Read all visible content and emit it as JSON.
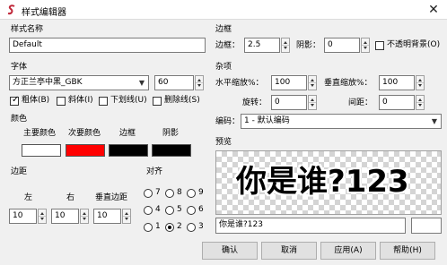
{
  "window": {
    "title": "样式编辑器",
    "close_symbol": "✕"
  },
  "left": {
    "style_name_label": "样式名称",
    "style_name_value": "Default",
    "font_label": "字体",
    "font_name": "方正兰亭中黑_GBK",
    "font_size": "60",
    "bold_label": "粗体(B)",
    "italic_label": "斜体(I)",
    "underline_label": "下划线(U)",
    "strikeout_label": "删除线(S)",
    "bold_checked": true,
    "italic_checked": false,
    "underline_checked": false,
    "strikeout_checked": false,
    "color_label": "颜色",
    "primary_color_label": "主要颜色",
    "secondary_color_label": "次要颜色",
    "outline_color_label": "边框",
    "shadow_color_label": "阴影",
    "primary_color": "#ffffff",
    "secondary_color": "#ff0000",
    "outline_color": "#000000",
    "shadow_color": "#000000",
    "margin_label": "边距",
    "margin_left_label": "左",
    "margin_right_label": "右",
    "margin_vertical_label": "垂直边距",
    "margin_left": "10",
    "margin_right": "10",
    "margin_vertical": "10",
    "align_label": "对齐",
    "align_options": [
      "7",
      "8",
      "9",
      "4",
      "5",
      "6",
      "1",
      "2",
      "3"
    ],
    "align_selected": "2"
  },
  "right": {
    "border_label": "边框",
    "outline_label": "边框：",
    "outline_value": "2.5",
    "shadow_label": "阴影：",
    "shadow_value": "0",
    "opaque_label": "不透明背景(O)",
    "opaque_checked": false,
    "misc_label": "杂项",
    "scale_x_label": "水平缩放%：",
    "scale_x_value": "100",
    "scale_y_label": "垂直缩放%：",
    "scale_y_value": "100",
    "rotation_label": "旋转：",
    "rotation_value": "0",
    "spacing_label": "间距：",
    "spacing_value": "0",
    "encoding_label": "编码：",
    "encoding_value": "1 - 默认编码",
    "preview_label": "预览",
    "preview_text": "你是谁?123",
    "preview_input": "你是谁?123"
  },
  "buttons": {
    "ok": "确认",
    "cancel": "取消",
    "apply": "应用(A)",
    "help": "帮助(H)"
  }
}
